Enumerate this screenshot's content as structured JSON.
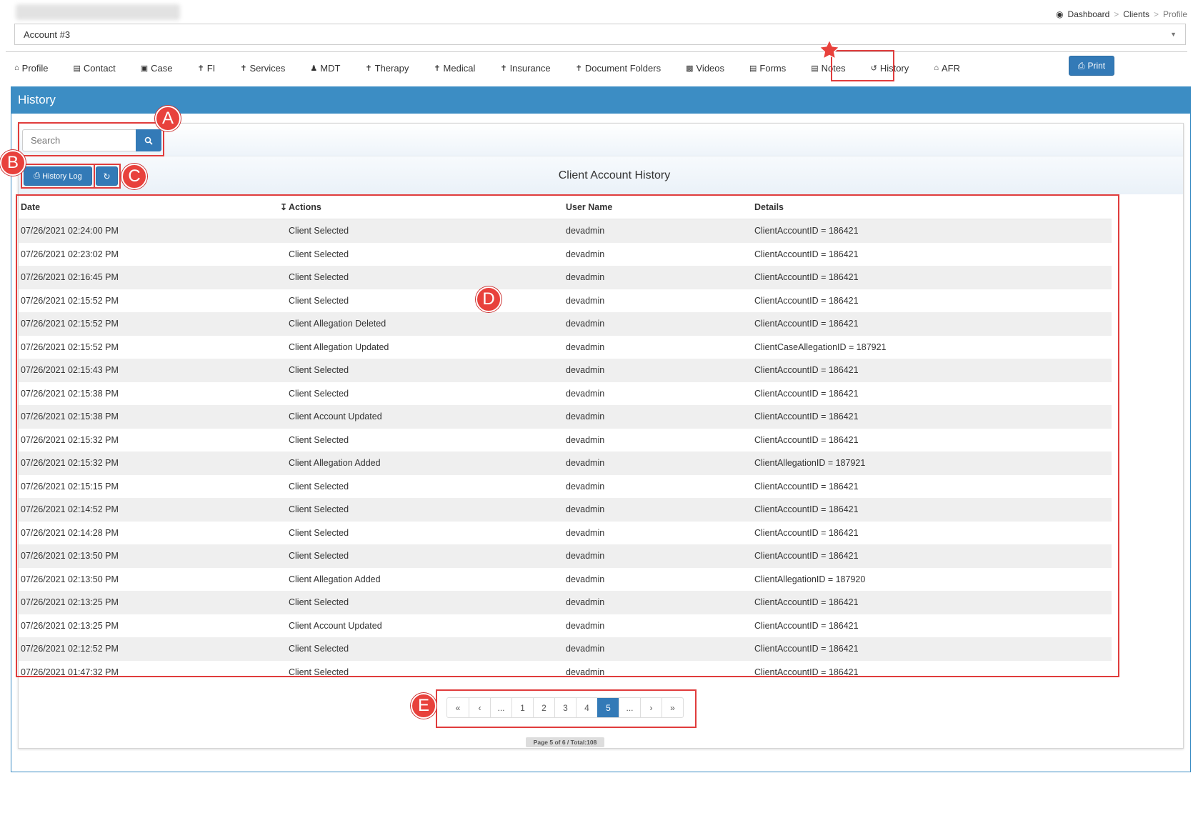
{
  "breadcrumb": {
    "items": [
      {
        "label": "Dashboard",
        "icon": "dashboard-icon"
      },
      {
        "label": "Clients"
      },
      {
        "label": "Profile"
      }
    ],
    "separator": ">"
  },
  "account_select": {
    "value": "Account #3"
  },
  "tabs": [
    {
      "label": "Profile",
      "icon": "home-icon"
    },
    {
      "label": "Contact",
      "icon": "contact-card-icon"
    },
    {
      "label": "Case",
      "icon": "briefcase-icon"
    },
    {
      "label": "FI",
      "icon": "child-icon"
    },
    {
      "label": "Services",
      "icon": "child-icon"
    },
    {
      "label": "MDT",
      "icon": "users-icon"
    },
    {
      "label": "Therapy",
      "icon": "child-icon"
    },
    {
      "label": "Medical",
      "icon": "child-icon"
    },
    {
      "label": "Insurance",
      "icon": "child-icon"
    },
    {
      "label": "Document Folders",
      "icon": "child-icon"
    },
    {
      "label": "Videos",
      "icon": "video-file-icon"
    },
    {
      "label": "Forms",
      "icon": "file-icon"
    },
    {
      "label": "Notes",
      "icon": "file-icon"
    },
    {
      "label": "History",
      "icon": "history-icon",
      "active": true
    },
    {
      "label": "AFR",
      "icon": "home-icon"
    }
  ],
  "print_button": {
    "label": "Print",
    "icon": "print-icon"
  },
  "panel": {
    "title": "History"
  },
  "search": {
    "placeholder": "Search",
    "icon": "search-icon"
  },
  "toolbar": {
    "history_log_label": "History Log",
    "refresh_icon": "refresh-icon"
  },
  "table": {
    "caption": "Client Account History",
    "columns": [
      "Date",
      "Actions",
      "User Name",
      "Details"
    ],
    "rows": [
      [
        "07/26/2021 02:24:00 PM",
        "Client Selected",
        "devadmin",
        "ClientAccountID = 186421"
      ],
      [
        "07/26/2021 02:23:02 PM",
        "Client Selected",
        "devadmin",
        "ClientAccountID = 186421"
      ],
      [
        "07/26/2021 02:16:45 PM",
        "Client Selected",
        "devadmin",
        "ClientAccountID = 186421"
      ],
      [
        "07/26/2021 02:15:52 PM",
        "Client Selected",
        "devadmin",
        "ClientAccountID = 186421"
      ],
      [
        "07/26/2021 02:15:52 PM",
        "Client Allegation Deleted",
        "devadmin",
        "ClientAccountID = 186421"
      ],
      [
        "07/26/2021 02:15:52 PM",
        "Client Allegation Updated",
        "devadmin",
        "ClientCaseAllegationID = 187921"
      ],
      [
        "07/26/2021 02:15:43 PM",
        "Client Selected",
        "devadmin",
        "ClientAccountID = 186421"
      ],
      [
        "07/26/2021 02:15:38 PM",
        "Client Selected",
        "devadmin",
        "ClientAccountID = 186421"
      ],
      [
        "07/26/2021 02:15:38 PM",
        "Client Account Updated",
        "devadmin",
        "ClientAccountID = 186421"
      ],
      [
        "07/26/2021 02:15:32 PM",
        "Client Selected",
        "devadmin",
        "ClientAccountID = 186421"
      ],
      [
        "07/26/2021 02:15:32 PM",
        "Client Allegation Added",
        "devadmin",
        "ClientAllegationID = 187921"
      ],
      [
        "07/26/2021 02:15:15 PM",
        "Client Selected",
        "devadmin",
        "ClientAccountID = 186421"
      ],
      [
        "07/26/2021 02:14:52 PM",
        "Client Selected",
        "devadmin",
        "ClientAccountID = 186421"
      ],
      [
        "07/26/2021 02:14:28 PM",
        "Client Selected",
        "devadmin",
        "ClientAccountID = 186421"
      ],
      [
        "07/26/2021 02:13:50 PM",
        "Client Selected",
        "devadmin",
        "ClientAccountID = 186421"
      ],
      [
        "07/26/2021 02:13:50 PM",
        "Client Allegation Added",
        "devadmin",
        "ClientAllegationID = 187920"
      ],
      [
        "07/26/2021 02:13:25 PM",
        "Client Selected",
        "devadmin",
        "ClientAccountID = 186421"
      ],
      [
        "07/26/2021 02:13:25 PM",
        "Client Account Updated",
        "devadmin",
        "ClientAccountID = 186421"
      ],
      [
        "07/26/2021 02:12:52 PM",
        "Client Selected",
        "devadmin",
        "ClientAccountID = 186421"
      ],
      [
        "07/26/2021 01:47:32 PM",
        "Client Selected",
        "devadmin",
        "ClientAccountID = 186421"
      ]
    ]
  },
  "pagination": {
    "items": [
      "«",
      "‹",
      "...",
      "1",
      "2",
      "3",
      "4",
      "5",
      "...",
      "›",
      "»"
    ],
    "active": "5",
    "info": "Page 5 of 6 / Total:108"
  },
  "annotations": {
    "labels": [
      "A",
      "B",
      "C",
      "D",
      "E"
    ],
    "color": "#e03c3c"
  },
  "colors": {
    "primary": "#337ab7",
    "panel_header": "#3c8dc4",
    "annotation_red": "#e03c3c"
  }
}
